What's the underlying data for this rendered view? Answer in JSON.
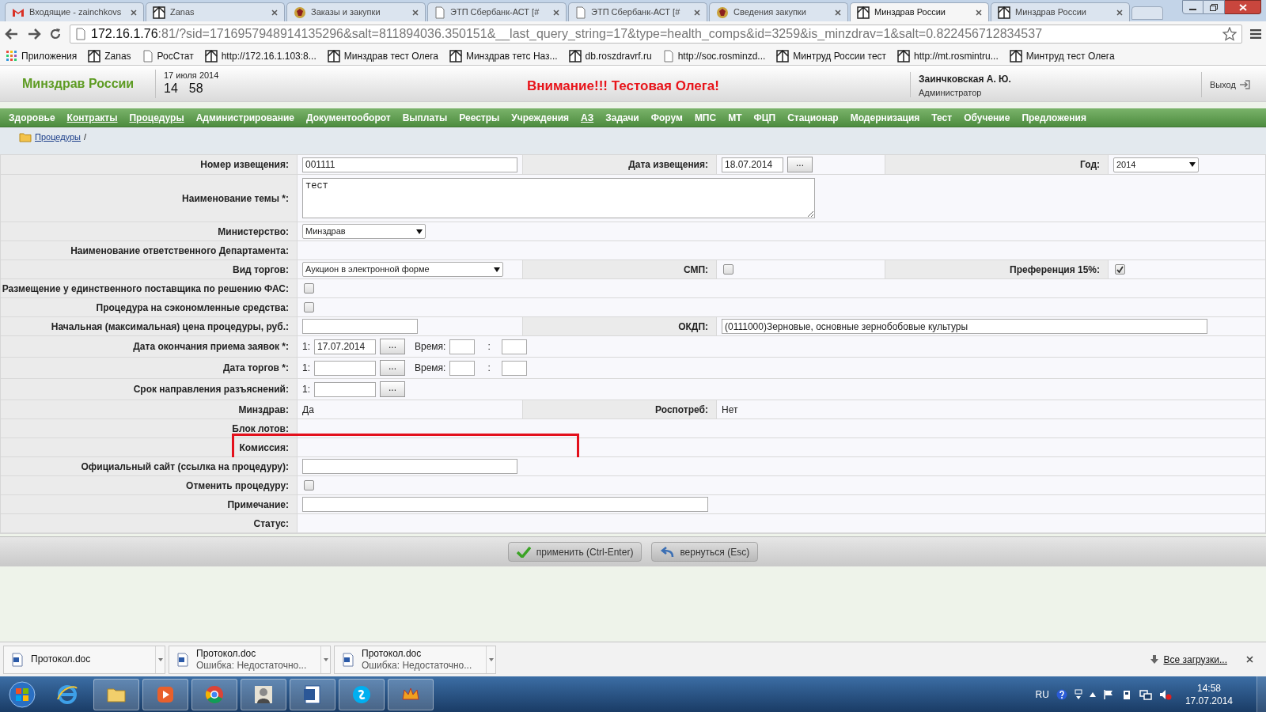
{
  "browser": {
    "tabs": [
      {
        "title": "Входящие - zainchkovs",
        "selected": false
      },
      {
        "title": "Zanas",
        "selected": false
      },
      {
        "title": "Заказы и закупки",
        "selected": false
      },
      {
        "title": "ЭТП Сбербанк-АСТ [#",
        "selected": false
      },
      {
        "title": "ЭТП Сбербанк-АСТ [#",
        "selected": false
      },
      {
        "title": "Сведения закупки",
        "selected": false
      },
      {
        "title": "Минздрав России",
        "selected": true
      },
      {
        "title": "Минздрав России",
        "selected": false
      }
    ],
    "address": {
      "host": "172.16.1.76",
      "rest": ":81/?sid=1716957948914135296&salt=811894036.350151&__last_query_string=17&type=health_comps&id=3259&is_minzdrav=1&salt=0.822456712834537"
    },
    "bookmarks": [
      {
        "label": "Приложения"
      },
      {
        "label": "Zanas"
      },
      {
        "label": "РосСтат"
      },
      {
        "label": "http://172.16.1.103:8..."
      },
      {
        "label": "Минздрав тест Олега"
      },
      {
        "label": "Минздрав тетс Наз..."
      },
      {
        "label": "db.roszdravrf.ru"
      },
      {
        "label": "http://soc.rosminzd..."
      },
      {
        "label": "Минтруд России тест"
      },
      {
        "label": "http://mt.rosmintru..."
      },
      {
        "label": "Минтруд тест Олега"
      }
    ]
  },
  "header": {
    "logo": "Минздрав России",
    "date": "17 июля 2014",
    "hours": "14",
    "minutes": "58",
    "warning": "Внимание!!! Тестовая Олега!",
    "user": "Заинчковская А. Ю.",
    "role": "Администратор",
    "logout": "Выход"
  },
  "menu": [
    {
      "label": "Здоровье",
      "underlined": false
    },
    {
      "label": "Контракты",
      "underlined": true
    },
    {
      "label": "Процедуры",
      "underlined": true
    },
    {
      "label": "Администрирование",
      "underlined": false
    },
    {
      "label": "Документооборот",
      "underlined": false
    },
    {
      "label": "Выплаты",
      "underlined": false
    },
    {
      "label": "Реестры",
      "underlined": false
    },
    {
      "label": "Учреждения",
      "underlined": false
    },
    {
      "label": "АЗ",
      "underlined": true
    },
    {
      "label": "Задачи",
      "underlined": false
    },
    {
      "label": "Форум",
      "underlined": false
    },
    {
      "label": "МПС",
      "underlined": false
    },
    {
      "label": "МТ",
      "underlined": false
    },
    {
      "label": "ФЦП",
      "underlined": false
    },
    {
      "label": "Стационар",
      "underlined": false
    },
    {
      "label": "Модернизация",
      "underlined": false
    },
    {
      "label": "Тест",
      "underlined": false
    },
    {
      "label": "Обучение",
      "underlined": false
    },
    {
      "label": "Предложения",
      "underlined": false
    }
  ],
  "breadcrumb": {
    "link": "Процедуры",
    "separator": "/"
  },
  "form": {
    "rows": [
      {
        "highlighted": false,
        "fields": [
          {
            "label": "Номер извещения:",
            "kind": "text",
            "value": "001111"
          },
          {
            "label": "Дата извещения:",
            "kind": "date",
            "value": "18.07.2014",
            "button": "..."
          },
          {
            "label": "Год:",
            "kind": "select",
            "value": "2014"
          }
        ]
      },
      {
        "highlighted": false,
        "fields": [
          {
            "label": "Наименование темы *:",
            "kind": "textarea",
            "value": "тест"
          }
        ]
      },
      {
        "highlighted": false,
        "fields": [
          {
            "label": "Министерство:",
            "kind": "select",
            "value": "Минздрав"
          }
        ]
      },
      {
        "highlighted": false,
        "fields": [
          {
            "label": "Наименование ответственного Департамента:",
            "kind": "empty"
          }
        ]
      },
      {
        "highlighted": false,
        "fields": [
          {
            "label": "Вид торгов:",
            "kind": "select",
            "value": "Аукцион в электронной форме"
          },
          {
            "label": "СМП:",
            "kind": "checkbox",
            "checked": false
          },
          {
            "label": "Преференция 15%:",
            "kind": "checkbox",
            "checked": true
          }
        ]
      },
      {
        "highlighted": false,
        "fields": [
          {
            "label": "Размещение у единственного поставщика по решению ФАС:",
            "kind": "checkbox",
            "checked": false
          }
        ]
      },
      {
        "highlighted": false,
        "fields": [
          {
            "label": "Процедура на сэкономленные средства:",
            "kind": "checkbox",
            "checked": false
          }
        ]
      },
      {
        "highlighted": false,
        "fields": [
          {
            "label": "Начальная (максимальная) цена процедуры, руб.:",
            "kind": "text"
          },
          {
            "label": "ОКДП:",
            "kind": "text",
            "value": "(0111000)Зерновые, основные зернобобовые культуры"
          }
        ]
      },
      {
        "highlighted": false,
        "fields": [
          {
            "label": "Дата окончания приема заявок *:",
            "kind": "schedule",
            "index": "1:",
            "value": "17.07.2014",
            "button": "...",
            "time_label": "Время:",
            "separator": ":"
          }
        ]
      },
      {
        "highlighted": false,
        "fields": [
          {
            "label": "Дата торгов *:",
            "kind": "schedule",
            "index": "1:",
            "button": "...",
            "time_label": "Время:",
            "separator": ":"
          }
        ]
      },
      {
        "highlighted": false,
        "fields": [
          {
            "label": "Срок направления разъяснений:",
            "kind": "indexed_date",
            "index": "1:",
            "button": "..."
          }
        ]
      },
      {
        "highlighted": false,
        "fields": [
          {
            "label": "Минздрав:",
            "kind": "static",
            "value": "Да"
          },
          {
            "label": "Роспотреб:",
            "kind": "static",
            "value": "Нет"
          }
        ]
      },
      {
        "highlighted": false,
        "fields": [
          {
            "label": "Блок лотов:",
            "kind": "empty"
          }
        ]
      },
      {
        "highlighted": true,
        "fields": [
          {
            "label": "Комиссия:",
            "kind": "empty"
          }
        ]
      },
      {
        "highlighted": false,
        "fields": [
          {
            "label": "Официальный сайт (ссылка на процедуру):",
            "kind": "text"
          }
        ]
      },
      {
        "highlighted": false,
        "fields": [
          {
            "label": "Отменить процедуру:",
            "kind": "checkbox",
            "checked": false
          }
        ]
      },
      {
        "highlighted": false,
        "fields": [
          {
            "label": "Примечание:",
            "kind": "text"
          }
        ]
      },
      {
        "highlighted": false,
        "fields": [
          {
            "label": "Статус:",
            "kind": "empty"
          }
        ]
      }
    ]
  },
  "actions": [
    {
      "label": "применить (Ctrl-Enter)"
    },
    {
      "label": "вернуться (Esc)"
    }
  ],
  "downloads": {
    "items": [
      {
        "file": "Протокол.doc"
      },
      {
        "file": "Протокол.doc",
        "status": "Ошибка: Недостаточно..."
      },
      {
        "file": "Протокол.doc",
        "status": "Ошибка: Недостаточно..."
      }
    ],
    "all": "Все загрузки..."
  },
  "taskbar": {
    "apps": [
      {
        "running": false
      },
      {
        "running": true
      },
      {
        "running": true
      },
      {
        "running": true
      },
      {
        "running": true
      },
      {
        "running": true
      },
      {
        "running": true
      },
      {
        "running": true
      }
    ],
    "language": "RU",
    "time": "14:58",
    "date": "17.07.2014"
  }
}
